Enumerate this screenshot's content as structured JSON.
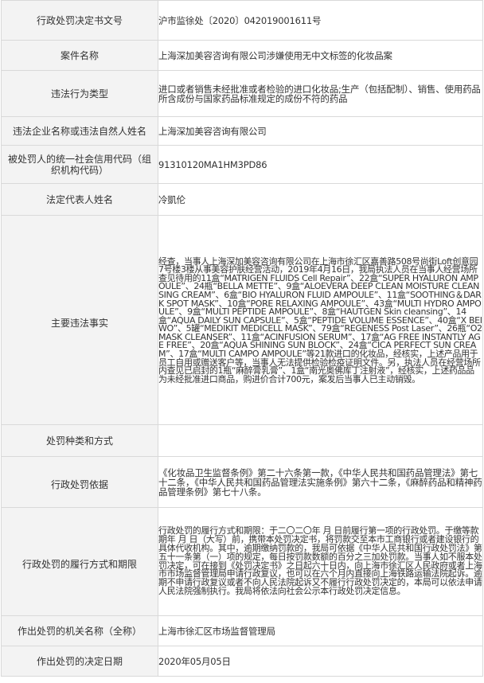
{
  "rows": [
    {
      "label": "行政处罚决定书文号",
      "value": "沪市监徐处〔2020〕042019001611号"
    },
    {
      "label": "案件名称",
      "value": "上海深加美容咨询有限公司涉嫌使用无中文标签的化妆品案"
    },
    {
      "label": "违法行为类型",
      "value": "进口或者销售未经批准或者检验的进口化妆品;生产（包括配制）、销售、使用药品所含成份与国家药品标准规定的成份不符的药品"
    },
    {
      "label": "违法企业名称或违法自然人姓名",
      "value": "上海深加美容咨询有限公司"
    },
    {
      "label": "被处罚人的统一社会信用代码（组织机构代码）",
      "value": "91310120MA1HM3PD86"
    },
    {
      "label": "法定代表人姓名",
      "value": "冷凱伦"
    },
    {
      "label": "主要违法事实",
      "value": "经查，当事人上海深加美容咨询有限公司在上海市徐汇区嘉善路508号尚街Loft创意园7号楼3楼从事美容护肤经营活动，2019年4月16日，我局执法人员在当事人经营场所查见待用的11盒“MATRIGEN FLUIDS Cell Repair”、22盒“SUPER HYALURON AMPOULE”、24瓶“BELLA METTE”、9盒“ALOEVERA DEEP CLEAN MOISTURE CLEANSING CREAM”、6盒“BIO HYALURON FLUID AMPOULE”、11盒“SOOTHING＆DARK SPOT MASK”、10盒“PORE RELAXING AMPOULE”、43盒“MULTI HYDRO AMPOULE”、9盒“MULTI PEPTIDE AMPOULE”、8盒“HAUTGEN Skin cleansing”、14盒“AQUA DAILY SUN CAPSULE”、5盒“PEPTIDE VOLUME ESSENCE”、40盒“X BEIWO”、5罐“MEDIKIT MEDICELL MASK”、79盒“REGENESS Post Laser”、26瓶“O2 MASK CLEANSER”、11盒“ACINFUSION SERUM”、17盒“AG FREE INSTANTLY AGE FREE”、20盒“AQUA SHINING SUN BLOCK”、24盒“CICA PERFECT SUN CREAM”、17盒“MULTI CAMPO AMPOULE”等21款进口的化妆品，经核实，上述产品用于员工自用或赠送客户等，当事人无法提供检验检疫证明文件。另，执法人员在经营场所内查见已启封的1瓶“麻醉膏乳膏”、1盒“南光奥佛库丁注射液”，经核实，上述药品品为未经批准进口商品，购进价合计700元，案发后当事人已主动销毁。"
    },
    {
      "label": "处罚种类和方式",
      "value": ""
    },
    {
      "label": "行政处罚依据",
      "value": "《化妆品卫生监督条例》第二十六条第一款，《中华人民共和国药品管理法》第七十二条，《中华人民共和国药品管理法实施条例》第六十二条，《麻醉药品和精神药品管理条例》第七十八条。"
    },
    {
      "label": "行政处罚的履行方式和期限",
      "value": "行政处罚的履行方式和期限：于二〇二〇年 月 日前履行第一项的行政处罚。于缴等款期年 月 日（大写）前，携带本处罚决定书，将罚款交至本市工商银行或者建设银行的具体代收机构。其中，逾期缴纳罚款的，我局可依据《中华人民共和国行政处罚法》第五十一条第（一）项的规定，每日按罚款数额的百分之三加处罚款。当事人如不服本处罚决定，可在接到《处罚决定书》之日起六十日内，向上海市徐汇区人民政府或者上海市市场监督管理局申请行政复议，也可以在六个月内直接向上海铁路运输法院起诉。逾期不申请行政复议或者不向人民法院起诉又不履行行政处罚决定的，本局可以依法申请人民法院强制执行。我局将依法向社会公示本行政处罚决定信息。"
    },
    {
      "label": "作出处罚的机关名称（全称）",
      "value": "上海市徐汇区市场监督管理局"
    },
    {
      "label": "作出处罚的决定日期",
      "value": "2020年05月05日"
    }
  ]
}
